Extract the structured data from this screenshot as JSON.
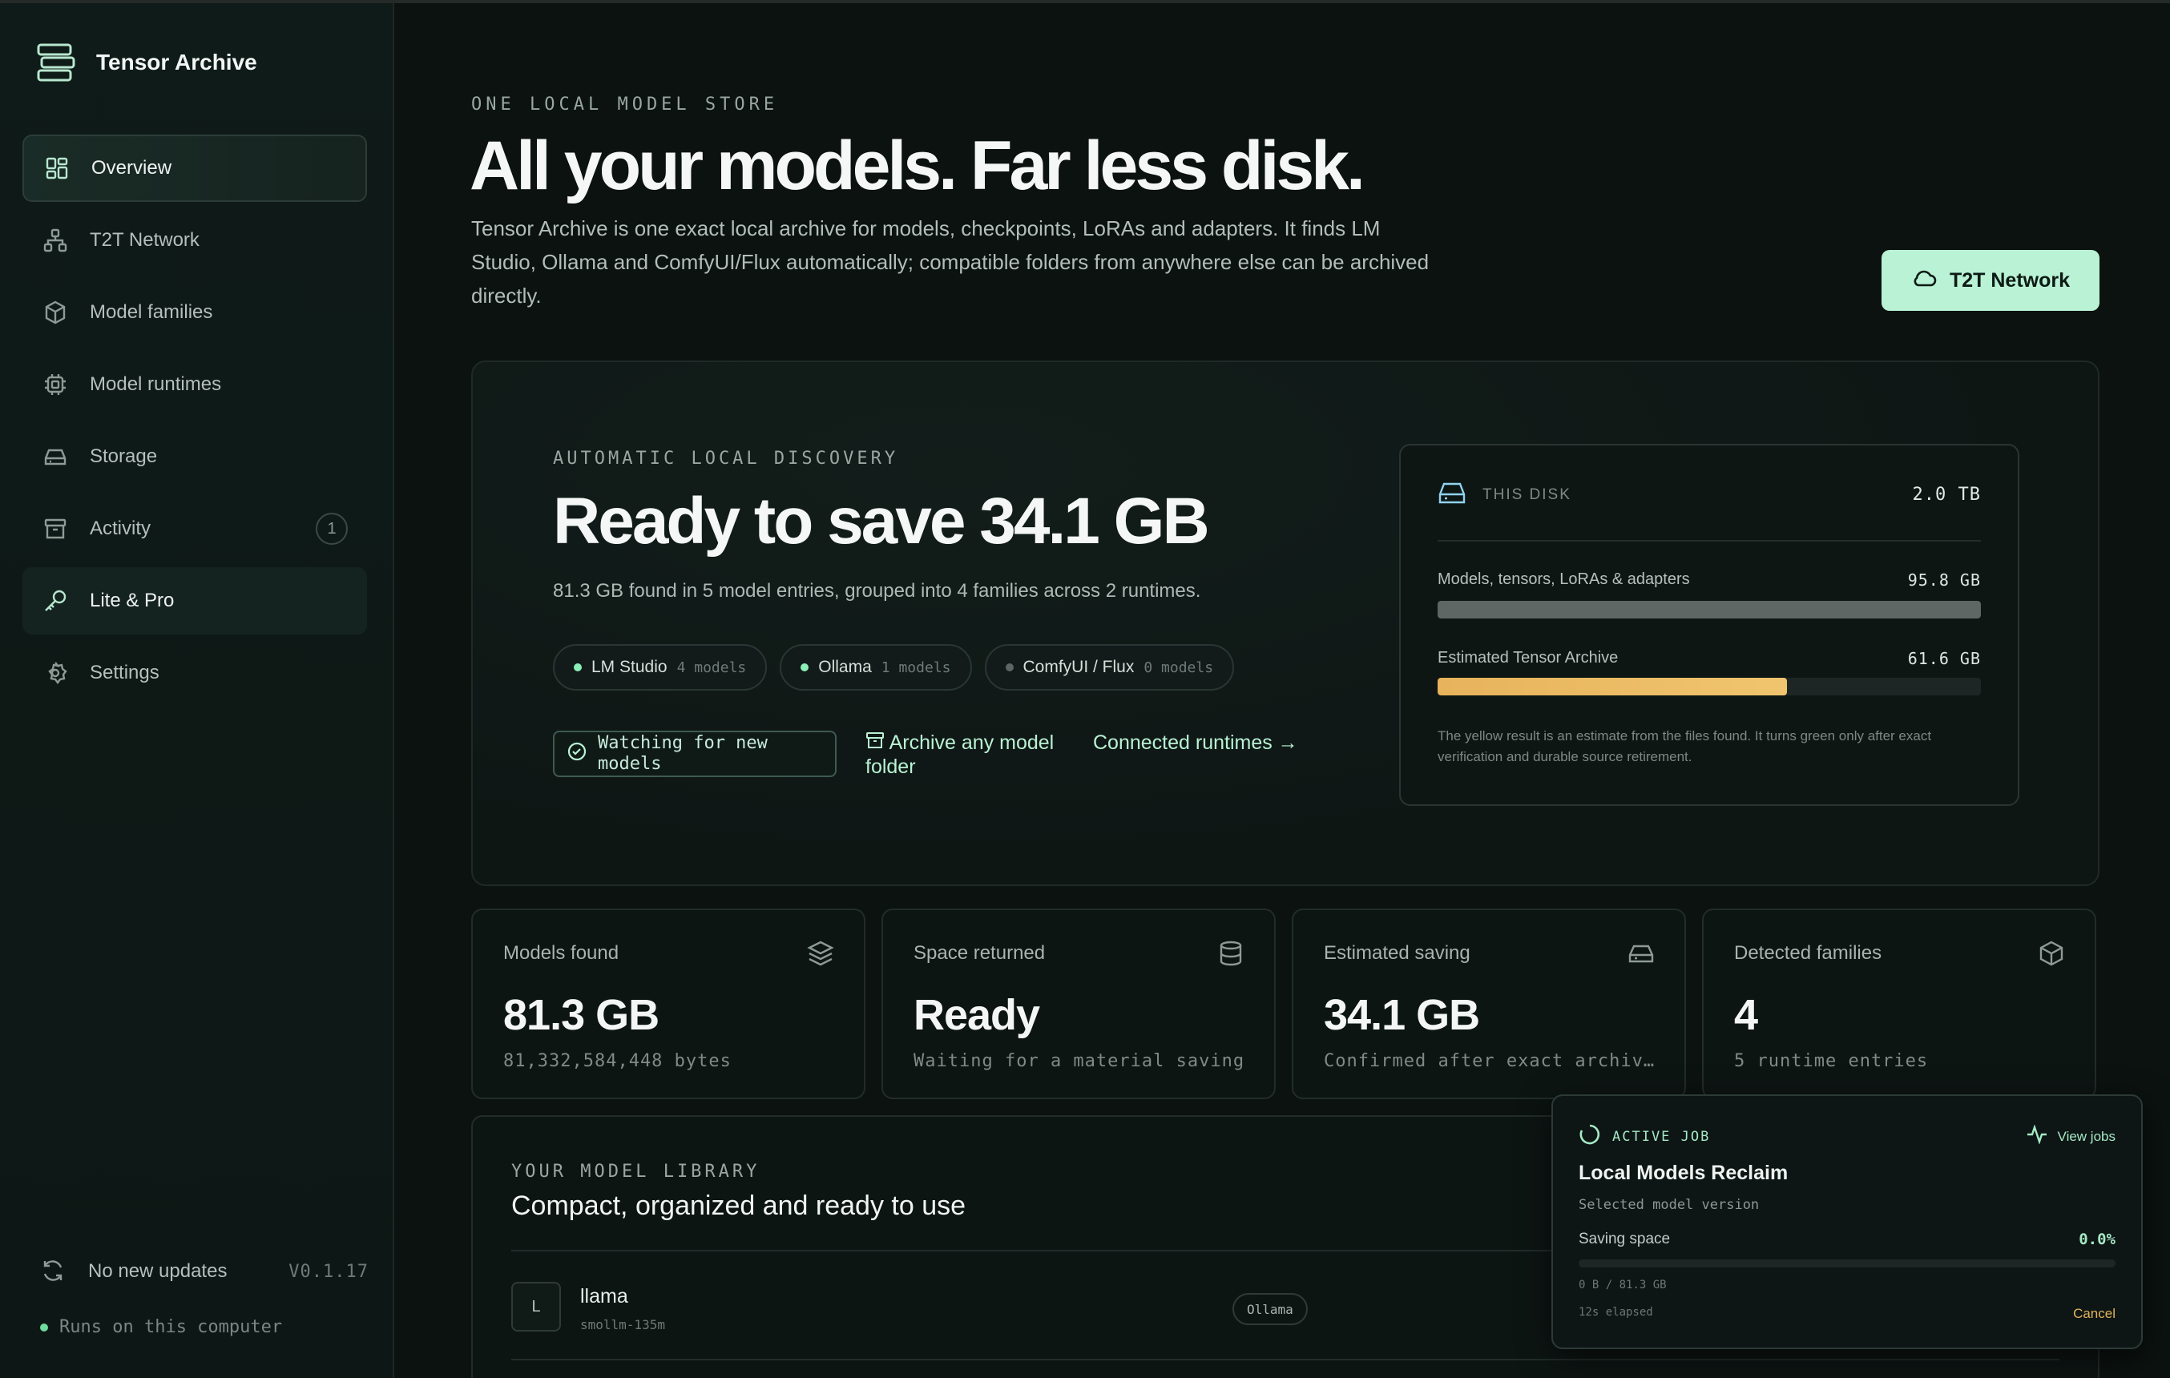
{
  "app": {
    "name": "Tensor Archive"
  },
  "sidebar": {
    "items": [
      {
        "label": "Overview",
        "icon": "grid-icon",
        "state": "active"
      },
      {
        "label": "T2T Network",
        "icon": "network-icon"
      },
      {
        "label": "Model families",
        "icon": "cube-icon"
      },
      {
        "label": "Model runtimes",
        "icon": "chip-icon"
      },
      {
        "label": "Storage",
        "icon": "drive-icon"
      },
      {
        "label": "Activity",
        "icon": "archive-box-icon",
        "badge": "1"
      },
      {
        "label": "Lite & Pro",
        "icon": "key-icon",
        "state": "hover"
      },
      {
        "label": "Settings",
        "icon": "gear-icon"
      }
    ],
    "footer": {
      "updates": "No new updates",
      "version": "V0.1.17",
      "status": "Runs on this computer"
    }
  },
  "hero": {
    "eyebrow": "ONE LOCAL MODEL STORE",
    "title": "All your models. Far less disk.",
    "description": "Tensor Archive is one exact local archive for models, checkpoints, LoRAs and adapters. It finds LM Studio, Ollama and ComfyUI/Flux automatically; compatible folders from anywhere else can be archived directly.",
    "button": "T2T Network"
  },
  "discovery": {
    "eyebrow": "AUTOMATIC LOCAL DISCOVERY",
    "title": "Ready to save 34.1 GB",
    "description": "81.3 GB found in 5 model entries, grouped into 4 families across 2 runtimes.",
    "runtimes": [
      {
        "name": "LM Studio",
        "count": "4 models",
        "active": true
      },
      {
        "name": "Ollama",
        "count": "1 models",
        "active": true
      },
      {
        "name": "ComfyUI / Flux",
        "count": "0 models",
        "active": false
      }
    ],
    "watch_label": "Watching for new models",
    "archive_label": "Archive any model folder",
    "connected_label": "Connected runtimes →"
  },
  "disk": {
    "label": "THIS DISK",
    "capacity": "2.0 TB",
    "rows": [
      {
        "label": "Models, tensors, LoRAs & adapters",
        "value": "95.8 GB",
        "fill": 1.0,
        "color": "#5f6764"
      },
      {
        "label": "Estimated Tensor Archive",
        "value": "61.6 GB",
        "fill": 0.643,
        "color": "#e7b35c"
      }
    ],
    "note": "The yellow result is an estimate from the files found. It turns green only after exact verification and durable source retirement."
  },
  "stats": [
    {
      "label": "Models found",
      "value": "81.3 GB",
      "sub": "81,332,584,448 bytes",
      "icon": "layers-icon"
    },
    {
      "label": "Space returned",
      "value": "Ready",
      "sub": "Waiting for a material saving",
      "icon": "database-icon"
    },
    {
      "label": "Estimated saving",
      "value": "34.1 GB",
      "sub": "Confirmed after exact archive…",
      "icon": "drive-icon"
    },
    {
      "label": "Detected families",
      "value": "4",
      "sub": "5 runtime entries",
      "icon": "cube-icon"
    }
  ],
  "library": {
    "eyebrow": "YOUR MODEL LIBRARY",
    "title": "Compact, organized and ready to use",
    "rows": [
      {
        "avatar": "L",
        "name": "llama",
        "sub": "smollm-135m",
        "runtime": "Ollama"
      }
    ]
  },
  "job": {
    "label": "ACTIVE JOB",
    "view": "View jobs",
    "title": "Local Models Reclaim",
    "subtitle": "Selected model version",
    "metric": "Saving space",
    "percent": "0.0%",
    "progress": 0.0,
    "bytes": "0 B / 81.3 GB",
    "elapsed": "12s elapsed",
    "cancel": "Cancel"
  }
}
